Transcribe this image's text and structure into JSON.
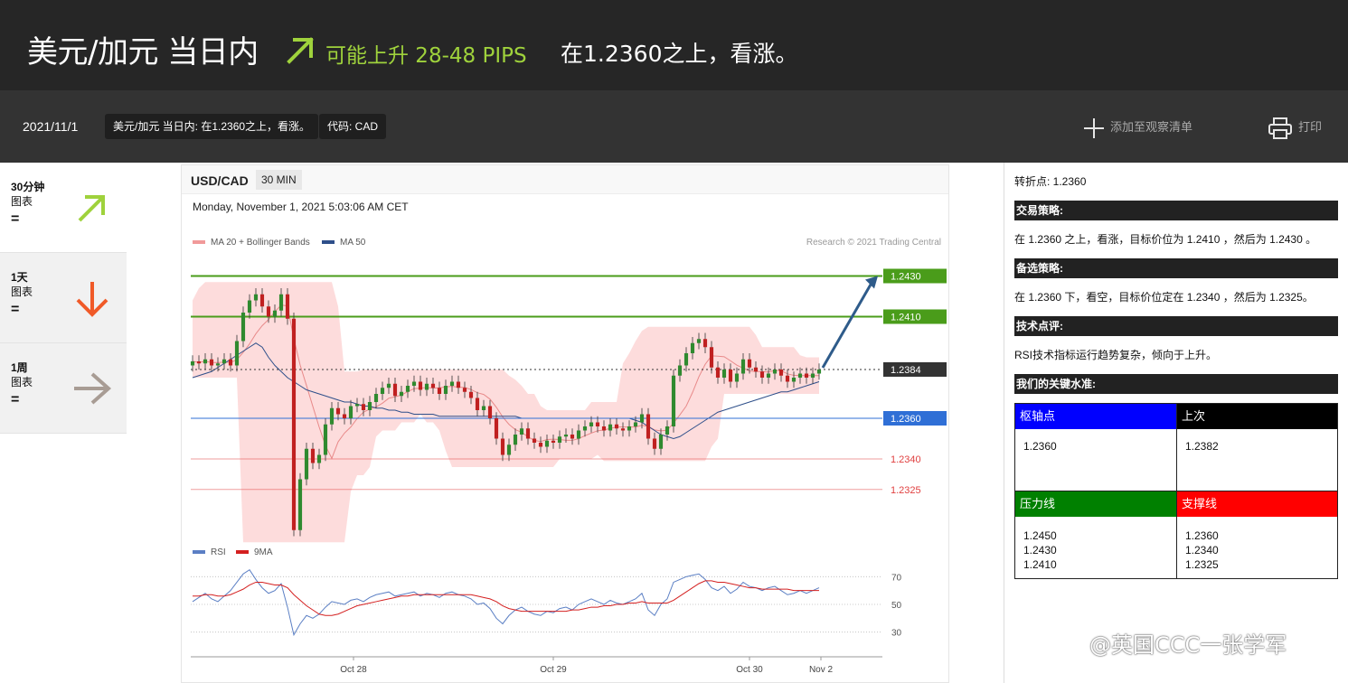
{
  "header": {
    "title": "美元/加元 当日内",
    "potential": "可能上升 28-48 PIPS",
    "condition": "在1.2360之上，看涨。",
    "arrow_color": "#9fd23c"
  },
  "subbar": {
    "date": "2021/11/1",
    "tag_title": "美元/加元 当日内: 在1.2360之上，看涨。",
    "tag_code": "代码: CAD",
    "watchlist_label": "添加至观察清单",
    "print_label": "打印"
  },
  "sidebar": {
    "items": [
      {
        "label": "30分钟",
        "sub": "图表",
        "eq": "=",
        "direction": "up",
        "color": "#9fd23c"
      },
      {
        "label": "1天",
        "sub": "图表",
        "eq": "=",
        "direction": "down",
        "color": "#f05a28"
      },
      {
        "label": "1周",
        "sub": "图表",
        "eq": "=",
        "direction": "right",
        "color": "#a89c94"
      }
    ]
  },
  "chart": {
    "symbol": "USD/CAD",
    "timeframe": "30 MIN",
    "timestamp": "Monday, November 1, 2021 5:03:06 AM CET",
    "legend_ma20": "MA 20 + Bollinger Bands",
    "legend_ma50": "MA 50",
    "copyright": "Research © 2021 Trading Central",
    "rsi_legend_rsi": "RSI",
    "rsi_legend_9ma": "9MA"
  },
  "chart_data": {
    "type": "line",
    "price_levels": [
      {
        "value": 1.243,
        "label": "1.2430",
        "color": "#4a9c1a"
      },
      {
        "value": 1.241,
        "label": "1.2410",
        "color": "#4a9c1a"
      },
      {
        "value": 1.2384,
        "label": "1.2384",
        "color": "#333333"
      },
      {
        "value": 1.236,
        "label": "1.2360",
        "color": "#2f6fd6"
      },
      {
        "value": 1.234,
        "label": "1.2340",
        "color": "#e04040"
      },
      {
        "value": 1.2325,
        "label": "1.2325",
        "color": "#e04040"
      }
    ],
    "ylim": [
      1.23,
      1.244
    ],
    "x_ticks": [
      "Oct 28",
      "Oct 29",
      "Oct 30",
      "Nov 2"
    ],
    "rsi_ticks": [
      70,
      50,
      30
    ],
    "rsi_ylim": [
      20,
      80
    ],
    "close": [
      1.2388,
      1.2387,
      1.2389,
      1.2386,
      1.2387,
      1.2389,
      1.2386,
      1.2398,
      1.2412,
      1.2418,
      1.2421,
      1.2415,
      1.241,
      1.2413,
      1.2421,
      1.2409,
      1.2305,
      1.233,
      1.2345,
      1.2338,
      1.2342,
      1.2357,
      1.2365,
      1.2362,
      1.236,
      1.2366,
      1.2367,
      1.2364,
      1.2368,
      1.2372,
      1.2375,
      1.2377,
      1.2371,
      1.2373,
      1.2376,
      1.2378,
      1.2374,
      1.2377,
      1.2375,
      1.2372,
      1.2376,
      1.2378,
      1.2375,
      1.2373,
      1.237,
      1.2364,
      1.2366,
      1.236,
      1.235,
      1.2342,
      1.2347,
      1.2352,
      1.2355,
      1.235,
      1.2348,
      1.2346,
      1.2349,
      1.2348,
      1.2351,
      1.2352,
      1.235,
      1.2354,
      1.2356,
      1.2358,
      1.2356,
      1.2354,
      1.2357,
      1.2355,
      1.2354,
      1.2356,
      1.2358,
      1.2362,
      1.235,
      1.2345,
      1.2352,
      1.2356,
      1.2381,
      1.2386,
      1.2392,
      1.2397,
      1.2399,
      1.2395,
      1.2385,
      1.238,
      1.2384,
      1.2378,
      1.2382,
      1.2389,
      1.2385,
      1.2383,
      1.238,
      1.2382,
      1.2384,
      1.2381,
      1.2378,
      1.238,
      1.2382,
      1.238,
      1.2382,
      1.2384
    ],
    "ma50": [
      1.238,
      1.2381,
      1.2382,
      1.2383,
      1.2385,
      1.2387,
      1.2389,
      1.2391,
      1.2393,
      1.2395,
      1.2397,
      1.2395,
      1.239,
      1.2386,
      1.2383,
      1.238,
      1.2378,
      1.2376,
      1.2374,
      1.2373,
      1.2372,
      1.2371,
      1.237,
      1.2369,
      1.2368,
      1.2368,
      1.2367,
      1.2366,
      1.2366,
      1.2365,
      1.2365,
      1.2364,
      1.2364,
      1.2363,
      1.2363,
      1.2362,
      1.2362,
      1.2362,
      1.2362,
      1.2361,
      1.2361,
      1.2361,
      1.2361,
      1.2361,
      1.2361,
      1.2361,
      1.2361,
      1.2361,
      1.2361,
      1.2361,
      1.2361,
      1.2361,
      1.236,
      1.236,
      1.236,
      1.236,
      1.236,
      1.236,
      1.236,
      1.236,
      1.236,
      1.236,
      1.236,
      1.236,
      1.236,
      1.236,
      1.236,
      1.236,
      1.236,
      1.236,
      1.2359,
      1.2358,
      1.2356,
      1.2354,
      1.2352,
      1.2351,
      1.235,
      1.2351,
      1.2353,
      1.2355,
      1.2357,
      1.2359,
      1.2361,
      1.2363,
      1.2364,
      1.2365,
      1.2366,
      1.2367,
      1.2368,
      1.2369,
      1.237,
      1.2371,
      1.2372,
      1.2373,
      1.2373,
      1.2374,
      1.2375,
      1.2376,
      1.2377,
      1.2378
    ],
    "rsi": [
      52,
      55,
      58,
      54,
      52,
      56,
      60,
      66,
      72,
      75,
      68,
      62,
      58,
      60,
      65,
      48,
      28,
      36,
      42,
      40,
      43,
      48,
      52,
      51,
      50,
      53,
      54,
      52,
      55,
      57,
      58,
      59,
      56,
      57,
      58,
      59,
      56,
      58,
      57,
      55,
      58,
      59,
      57,
      56,
      54,
      50,
      51,
      47,
      40,
      36,
      42,
      46,
      48,
      45,
      43,
      42,
      45,
      44,
      47,
      48,
      46,
      50,
      52,
      54,
      52,
      50,
      53,
      51,
      50,
      52,
      54,
      58,
      46,
      42,
      50,
      54,
      66,
      68,
      70,
      71,
      72,
      68,
      62,
      60,
      63,
      58,
      61,
      66,
      63,
      62,
      60,
      62,
      63,
      60,
      57,
      58,
      60,
      58,
      60,
      62
    ],
    "rsi_9ma": [
      56,
      56,
      57,
      57,
      56,
      56,
      57,
      59,
      61,
      64,
      66,
      66,
      65,
      64,
      64,
      62,
      57,
      53,
      49,
      46,
      43,
      42,
      42,
      43,
      45,
      47,
      49,
      50,
      51,
      52,
      53,
      54,
      55,
      56,
      56,
      57,
      57,
      57,
      57,
      57,
      57,
      57,
      57,
      57,
      57,
      56,
      55,
      54,
      52,
      49,
      47,
      46,
      45,
      45,
      45,
      45,
      45,
      45,
      45,
      45,
      46,
      46,
      47,
      48,
      48,
      49,
      49,
      50,
      50,
      51,
      51,
      52,
      51,
      51,
      51,
      51,
      53,
      56,
      59,
      62,
      65,
      67,
      67,
      66,
      66,
      65,
      64,
      63,
      62,
      62,
      61,
      61,
      61,
      61,
      61,
      60,
      60,
      60,
      60,
      60
    ]
  },
  "right": {
    "pivot_text": "转折点: 1.2360",
    "strategy_title": "交易策略:",
    "strategy_text": "在 1.2360 之上，看涨，目标价位为 1.2410 ，然后为 1.2430 。",
    "alt_title": "备选策略:",
    "alt_text": "在 1.2360 下，看空，目标价位定在 1.2340 ，然后为 1.2325。",
    "tech_title": "技术点评:",
    "tech_text": "RSI技术指标运行趋势复杂，倾向于上升。",
    "levels_title": "我们的关键水准:",
    "pivot_head": "枢轴点",
    "pivot_value": "1.2360",
    "last_head": "上次",
    "last_value": "1.2382",
    "resist_head": "压力线",
    "resist_values": [
      "1.2450",
      "1.2430",
      "1.2410"
    ],
    "support_head": "支撑线",
    "support_values": [
      "1.2360",
      "1.2340",
      "1.2325"
    ],
    "colors": {
      "pivot": "#0000ff",
      "last": "#000000",
      "resist": "#008000",
      "support": "#ff0000"
    }
  },
  "watermark": "@英国CCC一张学军"
}
